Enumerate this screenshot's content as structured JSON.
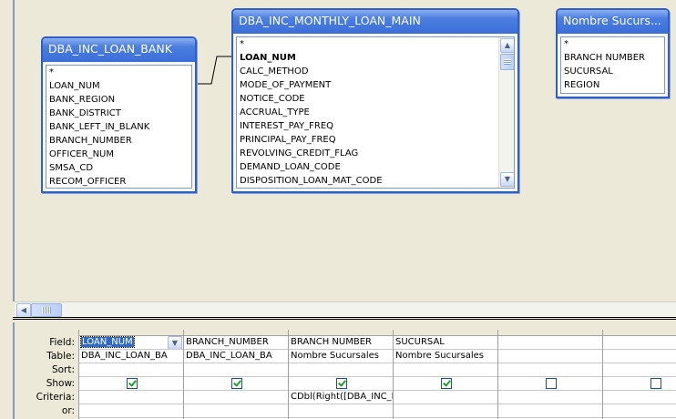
{
  "tables": {
    "loan_bank": {
      "title": "DBA_INC_LOAN_BANK",
      "fields": [
        "*",
        "LOAN_NUM",
        "BANK_REGION",
        "BANK_DISTRICT",
        "BANK_LEFT_IN_BLANK",
        "BRANCH_NUMBER",
        "OFFICER_NUM",
        "SMSA_CD",
        "RECOM_OFFICER"
      ]
    },
    "monthly_loan": {
      "title": "DBA_INC_MONTHLY_LOAN_MAIN",
      "fields": [
        "*",
        "LOAN_NUM",
        "CALC_METHOD",
        "MODE_OF_PAYMENT",
        "NOTICE_CODE",
        "ACCRUAL_TYPE",
        "INTEREST_PAY_FREQ",
        "PRINCIPAL_PAY_FREQ",
        "REVOLVING_CREDIT_FLAG",
        "DEMAND_LOAN_CODE",
        "DISPOSITION_LOAN_MAT_CODE"
      ],
      "bold_field": "LOAN_NUM"
    },
    "sucursales": {
      "title": "Nombre Sucurs...",
      "fields": [
        "*",
        "BRANCH NUMBER",
        "SUCURSAL",
        "REGION"
      ]
    }
  },
  "grid": {
    "row_labels": {
      "field": "Field:",
      "table": "Table:",
      "sort": "Sort:",
      "show": "Show:",
      "criteria": "Criteria:",
      "or": "or:"
    },
    "columns": [
      {
        "field": "LOAN_NUM",
        "table": "DBA_INC_LOAN_BA",
        "sort": "",
        "show": true,
        "criteria": "",
        "or": ""
      },
      {
        "field": "BRANCH_NUMBER",
        "table": "DBA_INC_LOAN_BA",
        "sort": "",
        "show": true,
        "criteria": "",
        "or": ""
      },
      {
        "field": "BRANCH NUMBER",
        "table": "Nombre Sucursales",
        "sort": "",
        "show": true,
        "criteria": "CDbl(Right([DBA_INC_I",
        "or": ""
      },
      {
        "field": "SUCURSAL",
        "table": "Nombre Sucursales",
        "sort": "",
        "show": true,
        "criteria": "",
        "or": ""
      },
      {
        "field": "",
        "table": "",
        "sort": "",
        "show": false,
        "criteria": "",
        "or": ""
      },
      {
        "field": "",
        "table": "",
        "sort": "",
        "show": false,
        "criteria": "",
        "or": ""
      }
    ]
  },
  "icons": {
    "scroll_up": "▲",
    "scroll_down": "▼",
    "scroll_left": "◀",
    "dropdown": "▼"
  },
  "colors": {
    "title_bar": "#3b6fd8",
    "window_bg": "#ece9d8",
    "selection": "#316ac5",
    "check": "#21a121"
  }
}
